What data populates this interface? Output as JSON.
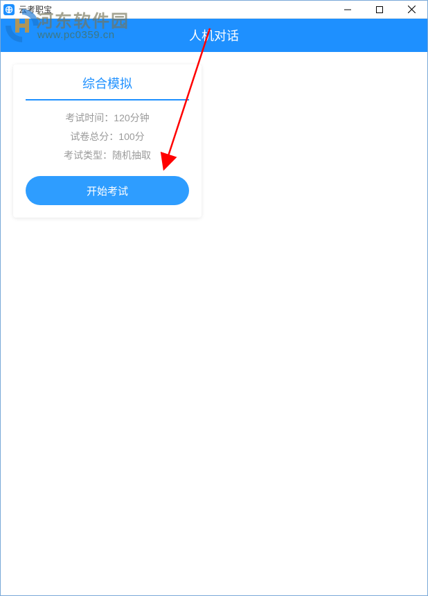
{
  "window": {
    "title": "云考职宝"
  },
  "header": {
    "title": "人机对话"
  },
  "card": {
    "title": "综合模拟",
    "exam_time_label": "考试时间：120分钟",
    "total_score_label": "试卷总分：100分",
    "exam_type_label": "考试类型：随机抽取",
    "start_button_label": "开始考试"
  },
  "watermark": {
    "line1": "河东软件园",
    "line2": "www.pc0359.cn"
  },
  "colors": {
    "primary": "#1e90ff",
    "button": "#2e9dff",
    "muted": "#9a9a9a"
  }
}
